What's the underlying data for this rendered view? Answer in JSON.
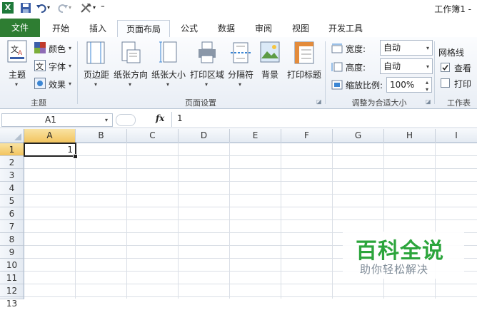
{
  "title": "工作簿1 -",
  "tabs": [
    {
      "label": "文件"
    },
    {
      "label": "开始"
    },
    {
      "label": "插入"
    },
    {
      "label": "页面布局"
    },
    {
      "label": "公式"
    },
    {
      "label": "数据"
    },
    {
      "label": "审阅"
    },
    {
      "label": "视图"
    },
    {
      "label": "开发工具"
    }
  ],
  "ribbon": {
    "theme": {
      "main": "主题",
      "colors": "颜色",
      "fonts": "字体",
      "effects": "效果",
      "group": "主题"
    },
    "page_setup": {
      "margins": "页边距",
      "orientation": "纸张方向",
      "size": "纸张大小",
      "print_area": "打印区域",
      "breaks": "分隔符",
      "background": "背景",
      "print_titles": "打印标题",
      "group": "页面设置"
    },
    "scale": {
      "width_label": "宽度:",
      "width_value": "自动",
      "height_label": "高度:",
      "height_value": "自动",
      "scale_label": "缩放比例:",
      "scale_value": "100%",
      "group": "调整为合适大小"
    },
    "sheet_options": {
      "gridlines": "网格线",
      "view": "查看",
      "print": "打印",
      "group": "工作表"
    }
  },
  "formula_bar": {
    "name_box": "A1",
    "fx": "fx",
    "content": "1"
  },
  "grid": {
    "columns": [
      "A",
      "B",
      "C",
      "D",
      "E",
      "F",
      "G",
      "H",
      "I"
    ],
    "rows": [
      "1",
      "2",
      "3",
      "4",
      "5",
      "6",
      "7",
      "8",
      "9",
      "10",
      "11",
      "12",
      "13"
    ],
    "a1_value": "1"
  },
  "watermark": {
    "main": "百科全说",
    "sub": "助你轻松解决"
  },
  "colors": {
    "file_tab": "#2e7d32",
    "selection_header": "#f2c45f",
    "watermark": "#2ca53c"
  }
}
